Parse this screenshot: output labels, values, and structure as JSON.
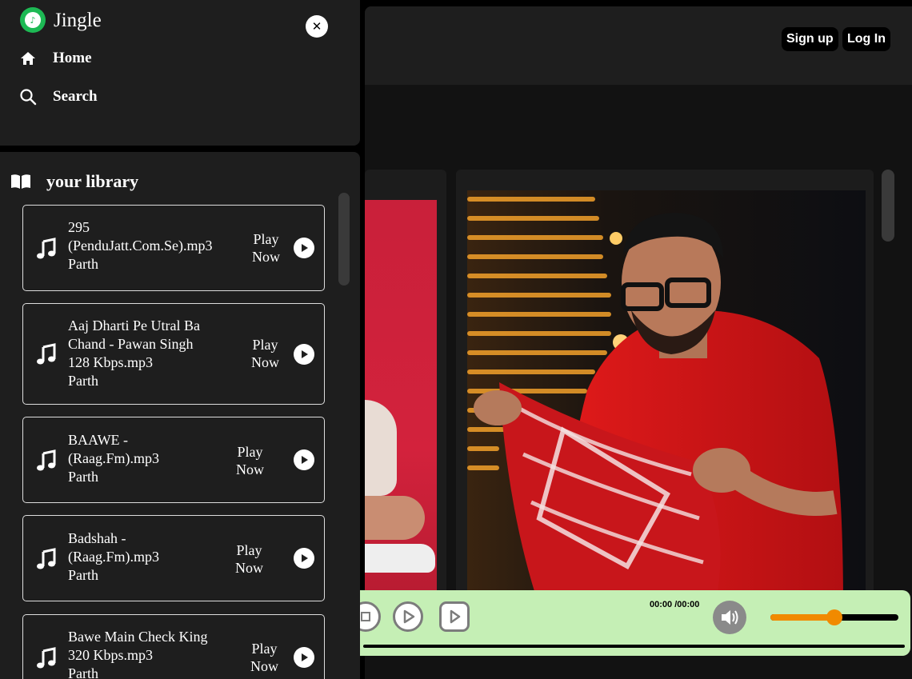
{
  "app": {
    "brand": "Jingle"
  },
  "nav": [
    {
      "label": "Home",
      "icon": "home-icon"
    },
    {
      "label": "Search",
      "icon": "search-icon"
    }
  ],
  "library": {
    "title": "your library",
    "songs": [
      {
        "title_lines": [
          "295",
          "(PenduJatt.Com.Se).mp3"
        ],
        "artist": "Parth",
        "play_label": [
          "Play",
          "Now"
        ]
      },
      {
        "title_lines": [
          "Aaj Dharti Pe Utral Ba",
          "Chand - Pawan Singh",
          "128 Kbps.mp3"
        ],
        "artist": "Parth",
        "play_label": [
          "Play",
          "Now"
        ]
      },
      {
        "title_lines": [
          "BAAWE -",
          "(Raag.Fm).mp3"
        ],
        "artist": "Parth",
        "play_label": [
          "Play",
          "Now"
        ]
      },
      {
        "title_lines": [
          "Badshah -",
          "(Raag.Fm).mp3"
        ],
        "artist": "Parth",
        "play_label": [
          "Play",
          "Now"
        ]
      },
      {
        "title_lines": [
          "Bawe Main Check King",
          "320 Kbps.mp3"
        ],
        "artist": "Parth",
        "play_label": [
          "Play",
          "Now"
        ]
      }
    ]
  },
  "header": {
    "signup_label": "Sign up",
    "login_label": "Log In"
  },
  "player": {
    "time": "00:00 /00:00",
    "volume": 0.5,
    "progress": 0.0,
    "accent": "#f18a00",
    "bar_color": "#c5efb5"
  },
  "colors": {
    "brand_green": "#1db954",
    "panel": "#1e1e1e",
    "background": "#121212"
  }
}
